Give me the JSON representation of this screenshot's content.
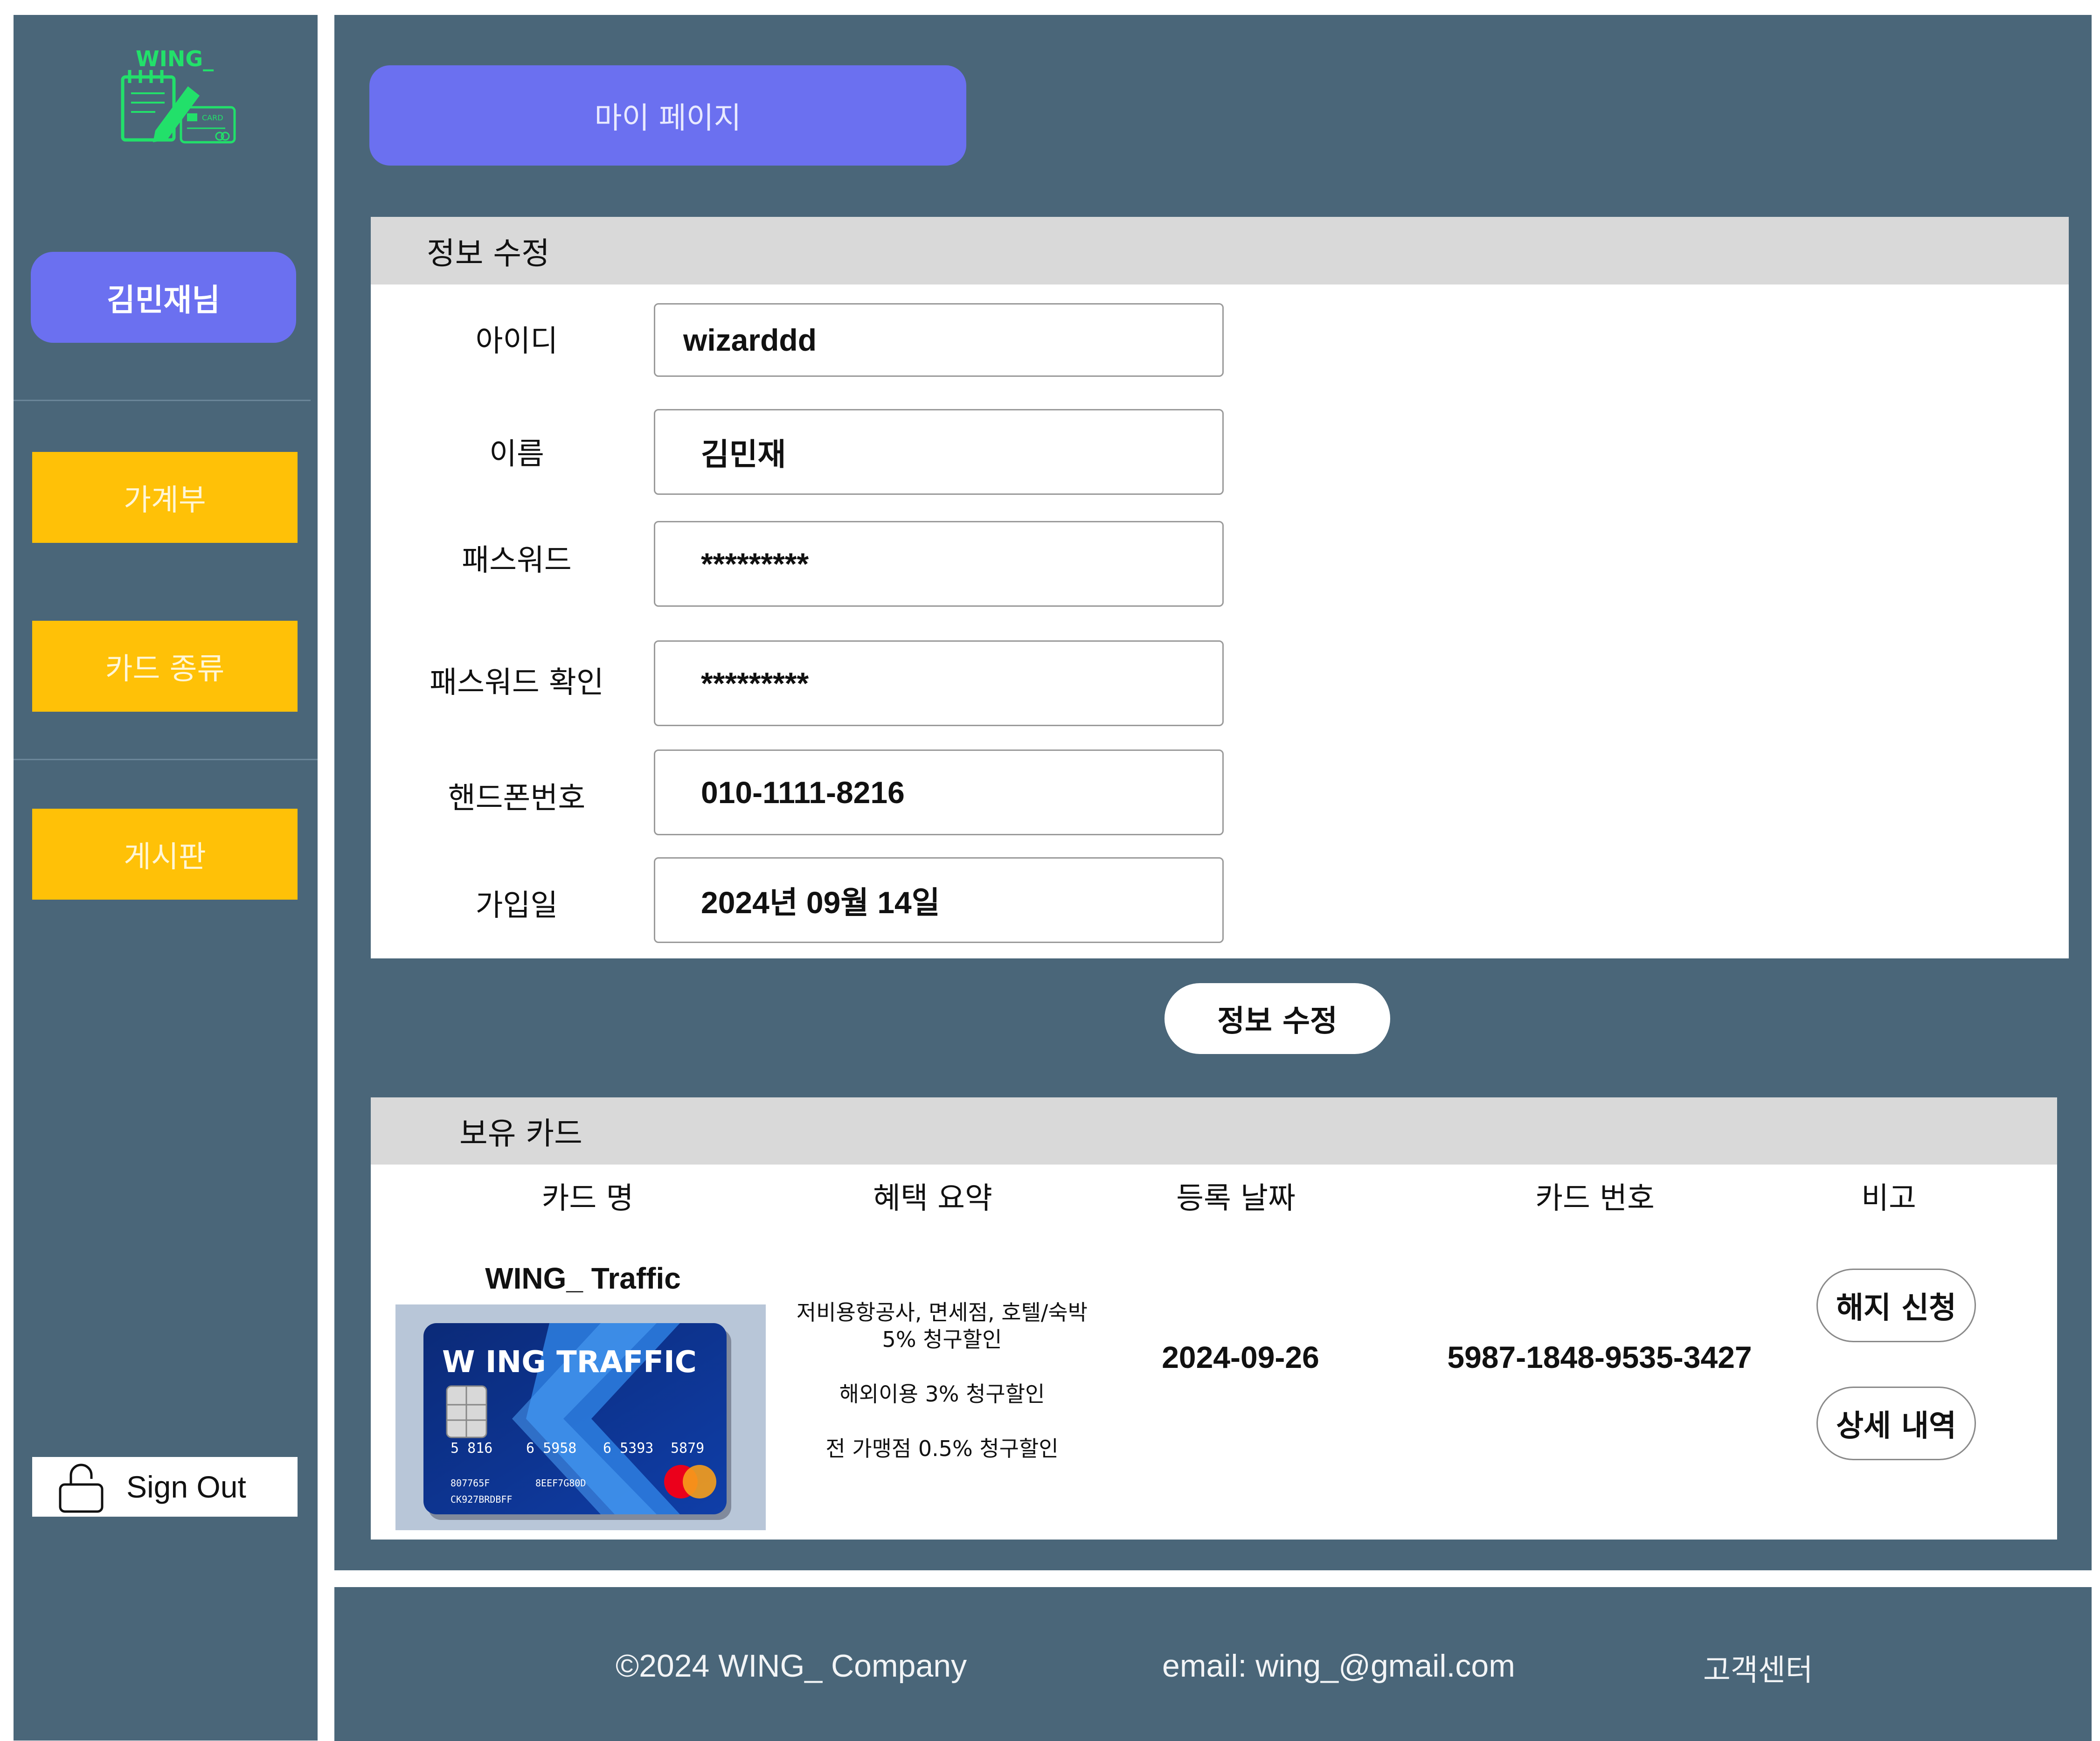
{
  "brand": {
    "logo_text": "WING_",
    "logo_card_text": "CARD"
  },
  "sidebar": {
    "user_name": "김민재님",
    "nav": [
      {
        "label": "가계부"
      },
      {
        "label": "카드 종류"
      },
      {
        "label": "게시판"
      }
    ],
    "sign_out": "Sign Out"
  },
  "header": {
    "title": "마이 페이지"
  },
  "profile": {
    "section_title": "정보 수정",
    "fields": [
      {
        "label": "아이디",
        "value": "wizarddd"
      },
      {
        "label": "이름",
        "value": "김민재"
      },
      {
        "label": "패스워드",
        "value": "*********"
      },
      {
        "label": "패스워드 확인",
        "value": "*********"
      },
      {
        "label": "핸드폰번호",
        "value": "010-1111-8216"
      },
      {
        "label": "가입일",
        "value": "2024년 09월 14일"
      }
    ],
    "submit_label": "정보 수정"
  },
  "cards": {
    "section_title": "보유 카드",
    "columns": [
      "카드 명",
      "혜택 요약",
      "등록 날짜",
      "카드 번호",
      "비고"
    ],
    "rows": [
      {
        "name": "WING_ Traffic",
        "image": {
          "brand_text": "W ING TRAFFIC",
          "number_groups": [
            "5 816",
            "6 5958",
            "6 5393",
            "5879"
          ],
          "line1": "807765F",
          "line1b": "8EEF7G80D",
          "line2": "CK927BRDBFF"
        },
        "benefits": [
          "저비용항공사, 면세점, 호텔/숙박",
          "5% 청구할인",
          "해외이용 3% 청구할인",
          "전 가맹점 0.5% 청구할인"
        ],
        "registered": "2024-09-26",
        "number": "5987-1848-9535-3427",
        "actions": {
          "cancel": "해지 신청",
          "detail": "상세 내역"
        }
      }
    ]
  },
  "footer": {
    "copyright": "©2024 WING_ Company",
    "email": "email: wing_@gmail.com",
    "support": "고객센터"
  }
}
